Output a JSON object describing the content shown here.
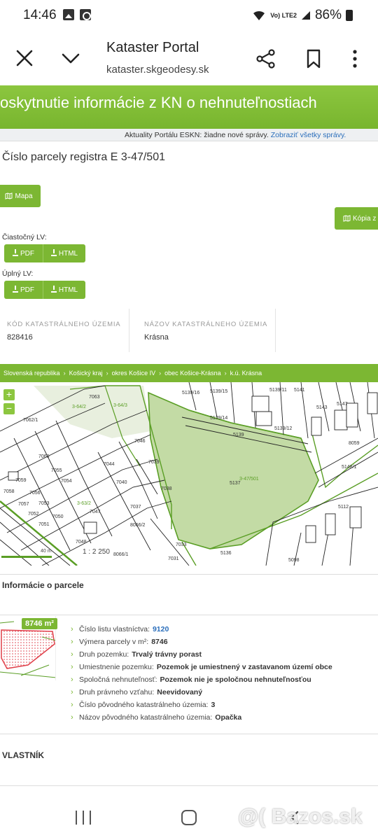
{
  "status_bar": {
    "time": "14:46",
    "battery": "86%",
    "network": "Vo) LTE2"
  },
  "browser": {
    "title": "Kataster Portal",
    "url": "kataster.skgeodesy.sk"
  },
  "header": {
    "title": "oskytnutie informácie z KN o nehnuteľnostiach"
  },
  "news": {
    "text": "Aktuality Portálu ESKN: žiadne nové správy.",
    "link": "Zobraziť všetky správy."
  },
  "parcel": {
    "title": "Číslo parcely registra E 3-47/501"
  },
  "buttons": {
    "mapa": "Mapa",
    "kopia": "Kópia z",
    "pdf": "PDF",
    "html": "HTML"
  },
  "lv": {
    "partial_label": "Čiastočný LV:",
    "full_label": "Úplný LV:"
  },
  "cadastre": {
    "code_label": "KÓD KATASTRÁLNEHO ÚZEMIA",
    "code_value": "828416",
    "name_label": "NÁZOV KATASTRÁLNEHO ÚZEMIA",
    "name_value": "Krásna"
  },
  "breadcrumb": [
    "Slovenská republika",
    "Košický kraj",
    "okres Košice IV",
    "obec Košice-Krásna",
    "k.ú. Krásna"
  ],
  "map": {
    "scale": "1 : 2 250",
    "scale_bar_label": "40 m",
    "zoom_in": "+",
    "zoom_out": "−",
    "labels": {
      "l7063": "7063",
      "l3642": "3-64/2",
      "l3643": "3-64/3",
      "l7062": "7062/1",
      "l7046": "7046",
      "l513916": "5139/16",
      "l513915": "5139/15",
      "l513914": "5139/14",
      "l513911": "5139/11",
      "l513912": "5139/12",
      "l5141": "5141",
      "l5143": "5143",
      "l5147": "5147",
      "l5139": "5139",
      "l8059": "8059",
      "l7060": "7060",
      "l7055": "7055",
      "l7054": "7054",
      "l7044": "7044",
      "l7039": "7039",
      "l7040": "7040",
      "l7038": "7038",
      "l5137": "5137",
      "l347501": "3-47/501",
      "l7059": "7059",
      "l7058": "7058",
      "l7056": "7056",
      "l7057": "7057",
      "l7053": "7053",
      "l7052": "7052",
      "l7051": "7051",
      "l7050": "7050",
      "l3632": "3-63/2",
      "l7047": "7047",
      "l7037": "7037",
      "l80662": "8066/2",
      "l7048": "7048",
      "l7033": "7033",
      "l5136": "5136",
      "l80661": "8066/1",
      "l7031": "7031",
      "l5098": "5098",
      "l5112": "5112",
      "l51481": "5148/1"
    }
  },
  "parcel_info": {
    "title": "Informácie o parcele",
    "area_badge": "8746 m²",
    "rows": [
      {
        "label": "Číslo listu vlastníctva:",
        "value": "9120"
      },
      {
        "label": "Výmera parcely v m²:",
        "value": "8746"
      },
      {
        "label": "Druh pozemku:",
        "value": "Trvalý trávny porast"
      },
      {
        "label": "Umiestnenie pozemku:",
        "value": "Pozemok je umiestnený v zastavanom území obce"
      },
      {
        "label": "Spoločná nehnuteľnosť:",
        "value": "Pozemok nie je spoločnou nehnuteľnosťou"
      },
      {
        "label": "Druh právneho vzťahu:",
        "value": "Neevidovaný"
      },
      {
        "label": "Číslo pôvodného katastrálneho územia:",
        "value": "3"
      },
      {
        "label": "Názov pôvodného katastrálneho územia:",
        "value": "Opačka"
      }
    ]
  },
  "owner": {
    "title": "VLASTNÍK"
  },
  "watermark": "@( Bazos.sk"
}
